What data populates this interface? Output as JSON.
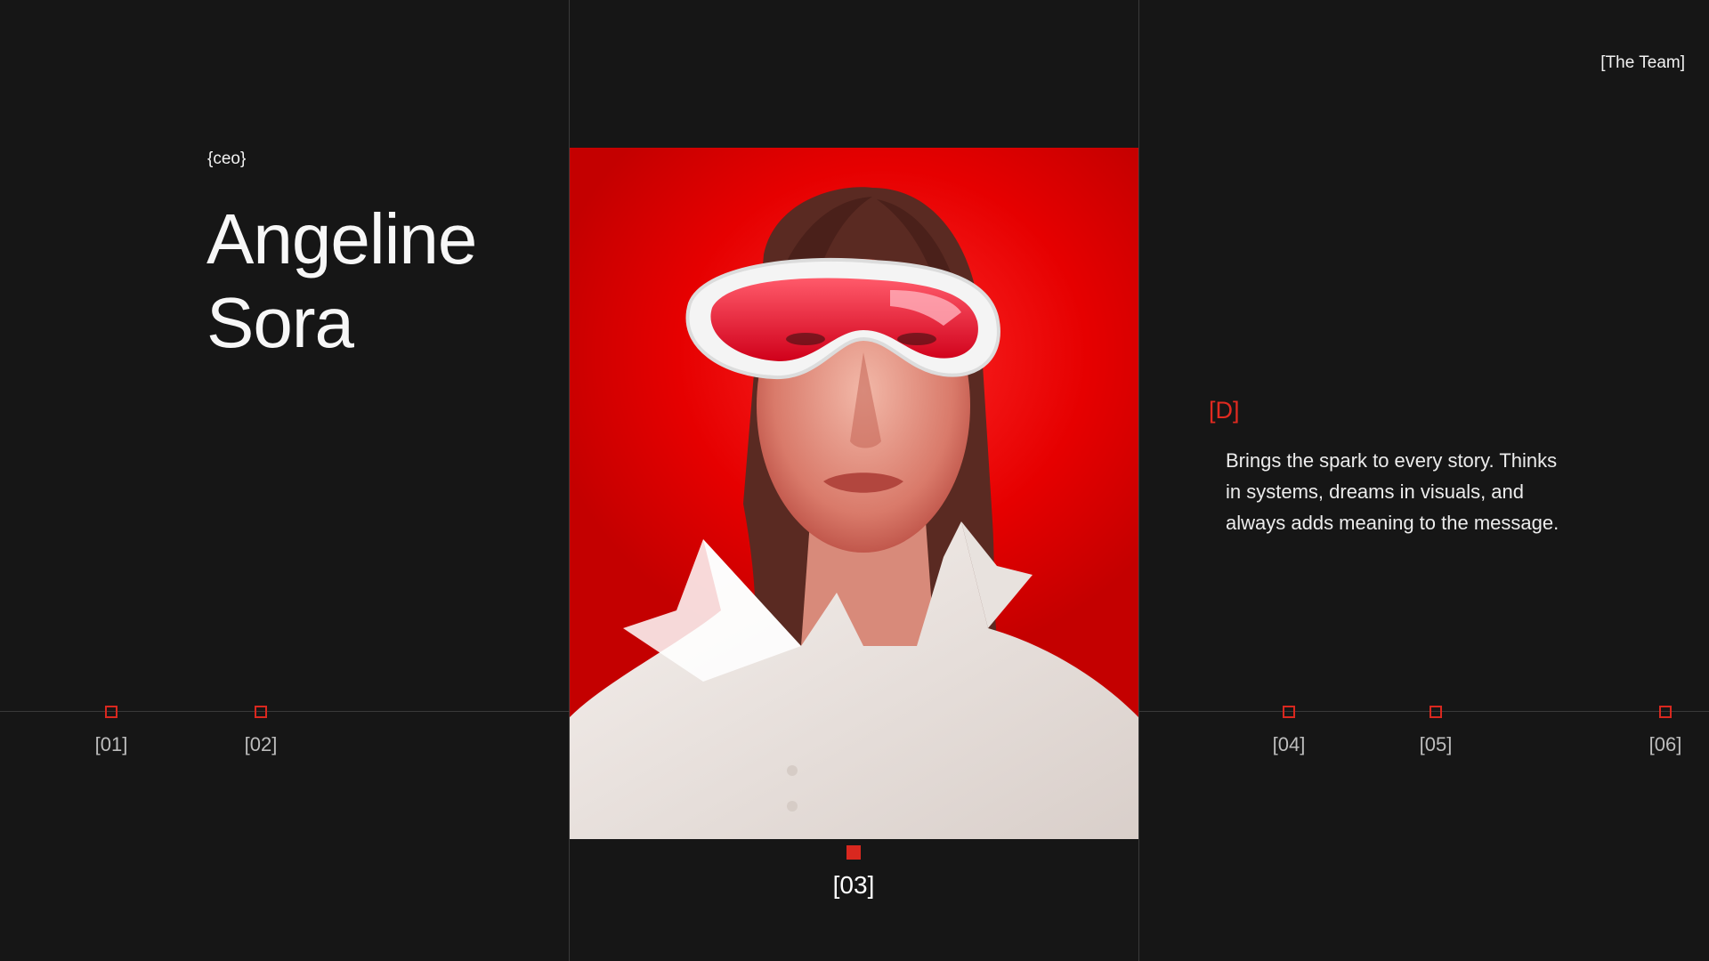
{
  "header": {
    "section_title": "[The Team]"
  },
  "member": {
    "role": "{ceo}",
    "first_name": "Angeline",
    "last_name": "Sora",
    "detail_letter": "[D]",
    "bio": "Brings the spark to every story. Thinks in systems, dreams in visuals, and always adds meaning to the message."
  },
  "timeline": {
    "items": [
      {
        "label": "[01]",
        "active": false
      },
      {
        "label": "[02]",
        "active": false
      },
      {
        "label": "[03]",
        "active": true
      },
      {
        "label": "[04]",
        "active": false
      },
      {
        "label": "[05]",
        "active": false
      },
      {
        "label": "[06]",
        "active": false
      }
    ]
  },
  "colors": {
    "accent": "#d9281f",
    "background": "#161616",
    "photo_bg": "#e60000"
  }
}
